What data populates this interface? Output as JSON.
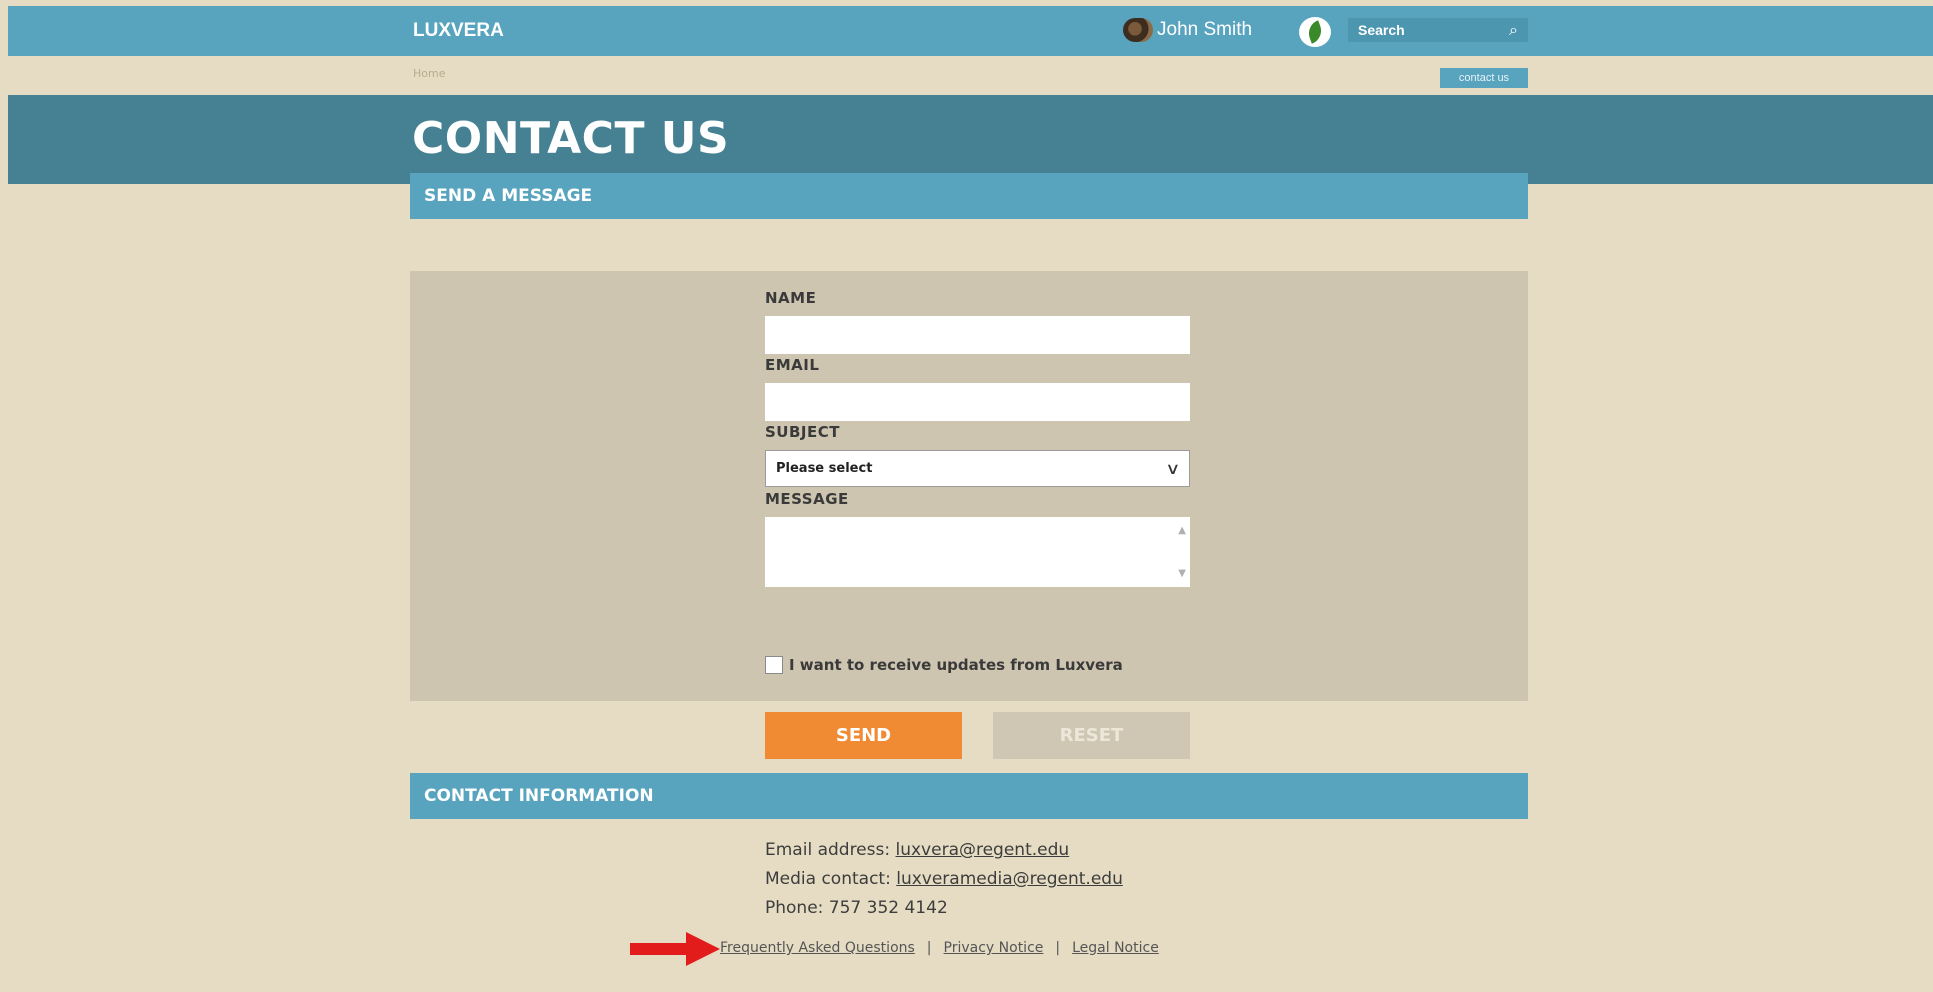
{
  "header": {
    "brand": "LUXVERA",
    "user_name": "John Smith",
    "search_label": "Search",
    "search_icon": "search-icon"
  },
  "breadcrumb": {
    "home": "Home",
    "contact_button": "contact us"
  },
  "page": {
    "title": "CONTACT US"
  },
  "form_section": {
    "heading": "SEND A MESSAGE",
    "name_label": "NAME",
    "email_label": "EMAIL",
    "subject_label": "SUBJECT",
    "subject_value": "Please select",
    "message_label": "MESSAGE",
    "checkbox_label": "I want to receive updates from Luxvera",
    "send_label": "SEND",
    "reset_label": "RESET"
  },
  "contact_info": {
    "heading": "CONTACT INFORMATION",
    "email_prefix": "Email address: ",
    "email": "luxvera@regent.edu",
    "media_prefix": "Media contact: ",
    "media_email": "luxveramedia@regent.edu",
    "phone": "Phone: 757 352 4142"
  },
  "footer": {
    "faq": "Frequently Asked Questions",
    "privacy": "Privacy Notice",
    "legal": "Legal Notice",
    "separator": "|"
  },
  "colors": {
    "topbar": "#58a4bf",
    "hero": "#468193",
    "background": "#e5dcc3",
    "panel": "#cdc5b0",
    "send": "#f08a33",
    "arrow": "#e21b1b"
  }
}
